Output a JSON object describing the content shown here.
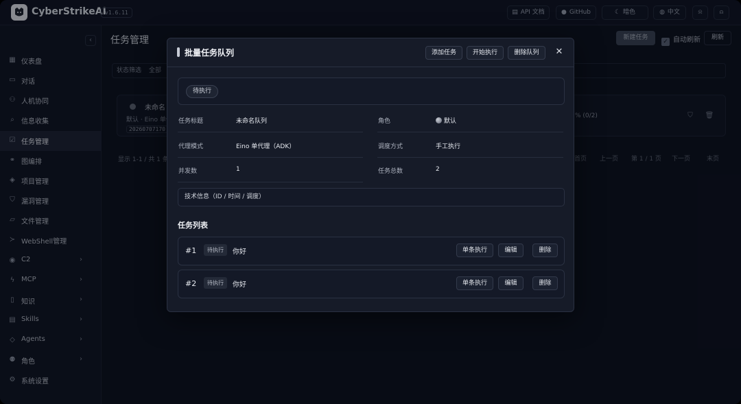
{
  "app": {
    "brand": "CyberStrikeAI",
    "version": "v1.6.11"
  },
  "topbar": {
    "api_docs": "API 文档",
    "github": "GitHub",
    "theme": "暗色",
    "language": "中文"
  },
  "sidebar": {
    "items": [
      {
        "label": "仪表盘",
        "icon": "dashboard-icon"
      },
      {
        "label": "对话",
        "icon": "chat-icon"
      },
      {
        "label": "人机协同",
        "icon": "user-collab-icon"
      },
      {
        "label": "信息收集",
        "icon": "search-icon"
      },
      {
        "label": "任务管理",
        "icon": "task-icon",
        "active": true
      },
      {
        "label": "图编排",
        "icon": "graph-icon"
      },
      {
        "label": "项目管理",
        "icon": "layers-icon"
      },
      {
        "label": "漏洞管理",
        "icon": "shield-icon"
      },
      {
        "label": "文件管理",
        "icon": "folder-icon"
      },
      {
        "label": "WebShell管理",
        "icon": "terminal-icon"
      },
      {
        "label": "C2",
        "icon": "broadcast-icon",
        "expandable": true
      },
      {
        "label": "MCP",
        "icon": "bolt-icon",
        "expandable": true
      },
      {
        "label": "知识",
        "icon": "book-icon",
        "expandable": true
      },
      {
        "label": "Skills",
        "icon": "document-icon",
        "expandable": true
      },
      {
        "label": "Agents",
        "icon": "stack-icon",
        "expandable": true
      },
      {
        "label": "角色",
        "icon": "users-icon",
        "expandable": true
      },
      {
        "label": "系统设置",
        "icon": "gear-icon"
      }
    ]
  },
  "main": {
    "title": "任务管理",
    "new_task": "新建任务",
    "auto_refresh": "自动刷新",
    "refresh": "刷新",
    "filter_label": "状态筛选",
    "filter_value": "全部",
    "card": {
      "name": "未命名",
      "sub": "默认 · Eino 单代",
      "id": "20260707170",
      "progress": "% (0/2)"
    },
    "pager": {
      "info": "显示 1-1 / 共 1 条",
      "first": "首页",
      "prev": "上一页",
      "current": "第 1 / 1 页",
      "next": "下一页",
      "last": "末页"
    }
  },
  "modal": {
    "title": "批量任务队列",
    "add_task": "添加任务",
    "start": "开始执行",
    "delete_queue": "删除队列",
    "status": "待执行",
    "fields": {
      "task_title_label": "任务标题",
      "task_title": "未命名队列",
      "role_label": "角色",
      "role": "默认",
      "agent_mode_label": "代理模式",
      "agent_mode": "Eino 单代理（ADK）",
      "schedule_label": "调度方式",
      "schedule": "手工执行",
      "concurrency_label": "并发数",
      "concurrency": "1",
      "total_label": "任务总数",
      "total": "2"
    },
    "tech_info": "技术信息（ID / 时间 / 调度）",
    "list_title": "任务列表",
    "tasks": [
      {
        "num": "#1",
        "status": "待执行",
        "text": "你好"
      },
      {
        "num": "#2",
        "status": "待执行",
        "text": "你好"
      }
    ],
    "row_actions": {
      "run_single": "单条执行",
      "edit": "编辑",
      "delete": "删除"
    }
  }
}
